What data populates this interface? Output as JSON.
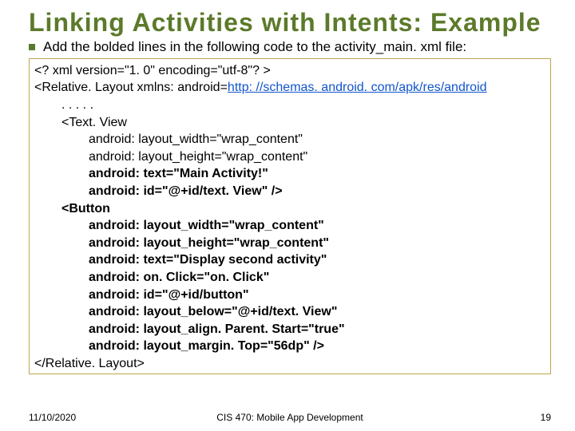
{
  "title": "Linking  Activities  with  Intents: Example",
  "bullet": "Add the bolded lines in the following code to the activity_main. xml file:",
  "code": {
    "l1": "<? xml version=\"1. 0\" encoding=\"utf-8\"? >",
    "l2a": "<Relative. Layout xmlns: android=",
    "l2b": "http: //schemas. android. com/apk/res/android",
    "l3": ". . . . .",
    "l4": "<Text. View",
    "l5": "android: layout_width=\"wrap_content\"",
    "l6": "android: layout_height=\"wrap_content\"",
    "l7": "android: text=\"Main Activity!\"",
    "l8": "android: id=\"@+id/text. View\" />",
    "l9": "<Button",
    "l10": "android: layout_width=\"wrap_content\"",
    "l11": "android: layout_height=\"wrap_content\"",
    "l12": "android: text=\"Display second activity\"",
    "l13": "android: on. Click=\"on. Click\"",
    "l14": "android: id=\"@+id/button\"",
    "l15": "android: layout_below=\"@+id/text. View\"",
    "l16": "android: layout_align. Parent. Start=\"true\"",
    "l17": "android: layout_margin. Top=\"56dp\" />",
    "l18": "</Relative. Layout>"
  },
  "footer": {
    "date": "11/10/2020",
    "course": "CIS 470: Mobile App Development",
    "page": "19"
  }
}
